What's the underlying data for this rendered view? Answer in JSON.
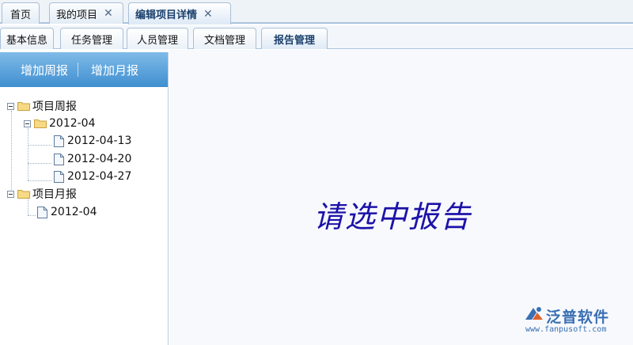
{
  "top_tabs": [
    {
      "label": "首页",
      "active": false,
      "closable": false
    },
    {
      "label": "我的项目",
      "active": false,
      "closable": true
    },
    {
      "label": "编辑项目详情",
      "active": true,
      "closable": true
    }
  ],
  "close_glyph": "✕",
  "sub_tabs": [
    {
      "label": "基本信息",
      "active": false
    },
    {
      "label": "任务管理",
      "active": false
    },
    {
      "label": "人员管理",
      "active": false
    },
    {
      "label": "文档管理",
      "active": false
    },
    {
      "label": "报告管理",
      "active": true
    }
  ],
  "toolbar": {
    "add_weekly": "增加周报",
    "add_monthly": "增加月报"
  },
  "tree": {
    "weekly_root": "项目周报",
    "weekly_month": "2012-04",
    "weekly_items": [
      "2012-04-13",
      "2012-04-20",
      "2012-04-27"
    ],
    "monthly_root": "项目月报",
    "monthly_items": [
      "2012-04"
    ]
  },
  "main": {
    "prompt": "请选中报告"
  },
  "brand": {
    "name": "泛普软件",
    "url": "www.fanpusoft.com"
  },
  "colors": {
    "toolbar": "#4d9ad6",
    "prompt": "#1c12a8",
    "brand": "#3a6fb3"
  }
}
